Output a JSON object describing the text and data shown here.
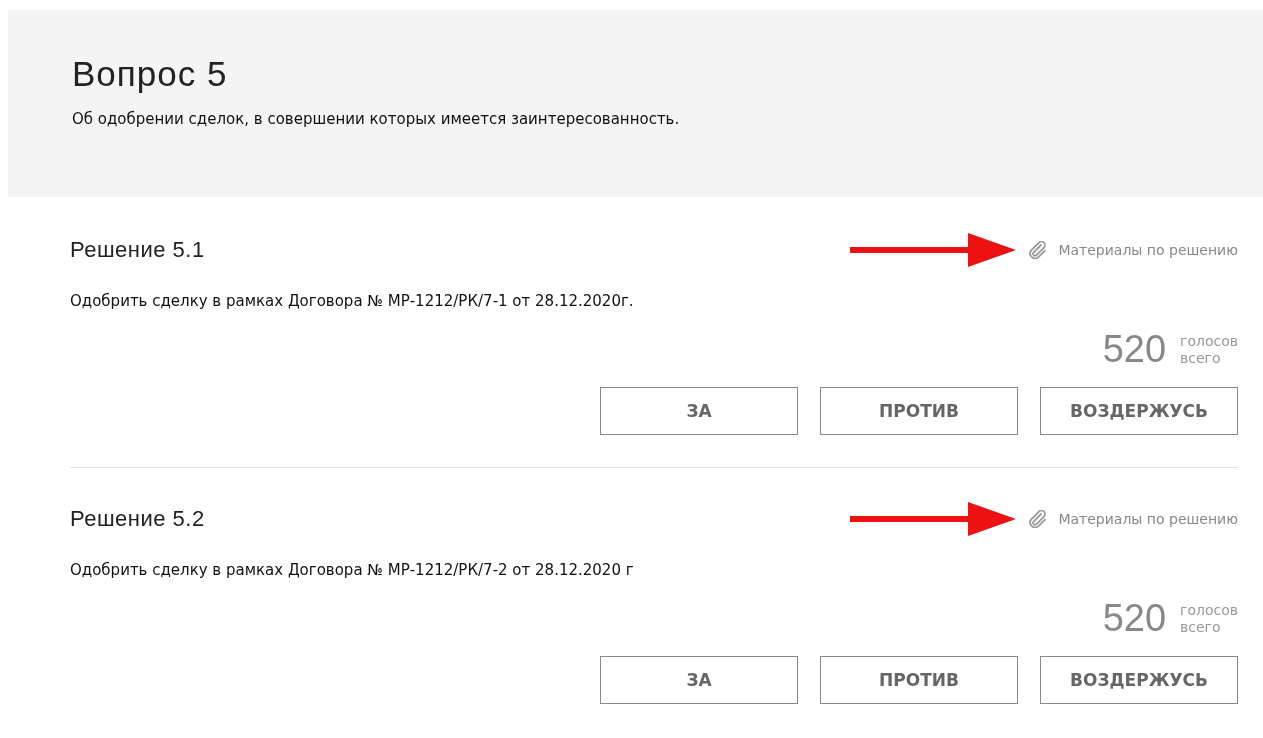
{
  "question": {
    "title": "Вопрос 5",
    "text": "Об одобрении сделок, в совершении которых имеется заинтересованность."
  },
  "decisions": [
    {
      "title": "Решение 5.1",
      "materials_link": "Материалы по решению",
      "text": "Одобрить сделку в рамках Договора № МР-1212/РК/7-1 от 28.12.2020г.",
      "votes": "520",
      "votes_label_1": "голосов",
      "votes_label_2": "всего",
      "buttons": [
        "ЗА",
        "ПРОТИВ",
        "ВОЗДЕРЖУСЬ"
      ]
    },
    {
      "title": "Решение 5.2",
      "materials_link": "Материалы по решению",
      "text": "Одобрить сделку в рамках Договора № МР-1212/РК/7-2 от 28.12.2020 г",
      "votes": "520",
      "votes_label_1": "голосов",
      "votes_label_2": "всего",
      "buttons": [
        "ЗА",
        "ПРОТИВ",
        "ВОЗДЕРЖУСЬ"
      ]
    }
  ]
}
